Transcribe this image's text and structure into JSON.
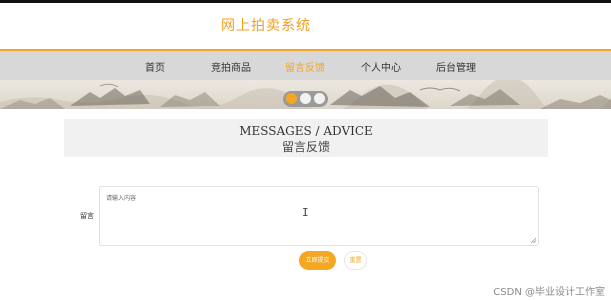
{
  "header": {
    "site_title": "网上拍卖系统"
  },
  "nav": {
    "items": [
      {
        "label": "首页"
      },
      {
        "label": "竞拍商品"
      },
      {
        "label": "留言反馈"
      },
      {
        "label": "个人中心"
      },
      {
        "label": "后台管理"
      }
    ],
    "active_index": 2
  },
  "carousel": {
    "slide_count": 3,
    "active_index": 0
  },
  "section": {
    "title_en": "MESSAGES / ADVICE",
    "title_cn": "留言反馈"
  },
  "form": {
    "label": "留言",
    "placeholder": "请输入内容",
    "value": ""
  },
  "buttons": {
    "submit": "立即提交",
    "reset": "重置"
  },
  "watermark": "CSDN @毕业设计工作室",
  "colors": {
    "accent": "#f5a623",
    "nav_bg": "#d8d8d8",
    "section_bg": "#f1f1f1"
  }
}
